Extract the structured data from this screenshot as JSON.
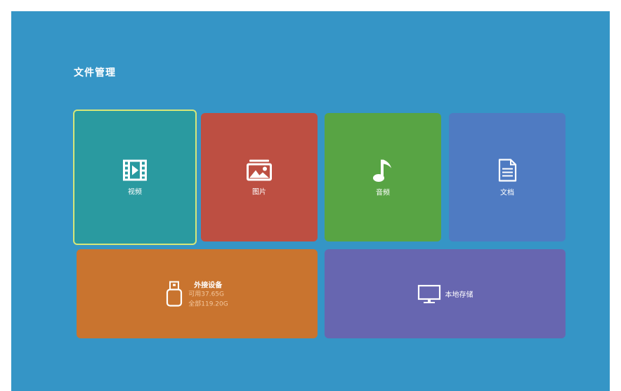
{
  "page": {
    "title": "文件管理"
  },
  "tiles": {
    "video": {
      "label": "视频",
      "icon": "video-film-icon",
      "color": "#2a9aa0",
      "focus_border": "#d7e778"
    },
    "pictures": {
      "label": "图片",
      "icon": "picture-icon",
      "color": "#bd4f42"
    },
    "music": {
      "label": "音频",
      "icon": "music-note-icon",
      "color": "#58a444"
    },
    "docs": {
      "label": "文档",
      "icon": "document-icon",
      "color": "#4f7bc2"
    },
    "external": {
      "title": "外接设备",
      "available": "可用37.65G",
      "total": "全部119.20G",
      "icon": "usb-drive-icon",
      "color": "#c9742f"
    },
    "local": {
      "label": "本地存储",
      "icon": "monitor-icon",
      "color": "#6766b0"
    }
  },
  "background": "#3595c6"
}
